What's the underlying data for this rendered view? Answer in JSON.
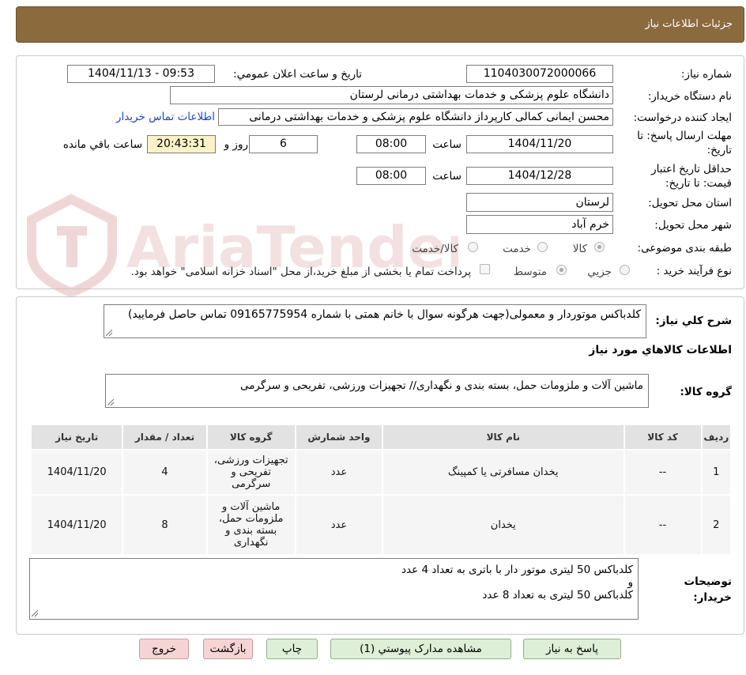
{
  "header": {
    "title": "جزئيات اطلاعات نياز"
  },
  "form": {
    "need_number_label": "شماره نياز:",
    "need_number": "1104030072000066",
    "announce_label": "تاريخ و ساعت اعلان عمومي:",
    "announce_value": "1404/11/13 - 09:53",
    "buyer_org_label": "نام دستگاه خريدار:",
    "buyer_org": "دانشگاه علوم پزشکی و خدمات بهداشتی درمانی لرستان",
    "requester_label": "ايجاد کننده درخواست:",
    "requester": "محسن ایمانی کمالی کارپرداز دانشگاه علوم پزشکی و خدمات بهداشتی درمانی",
    "contact_link": "اطلاعات تماس خريدار",
    "deadline_label_1": "مهلت ارسال پاسخ: تا",
    "deadline_label_2": "تاريخ:",
    "deadline_date": "1404/11/20",
    "time_word": "ساعت",
    "deadline_time": "08:00",
    "days": "6",
    "days_and": "روز و",
    "remaining": "20:43:31",
    "remaining_label": "ساعت باقي مانده",
    "validity_label_1": "حداقل تاريخ اعتبار",
    "validity_label_2": "قيمت: تا تاريخ:",
    "validity_date": "1404/12/28",
    "validity_time": "08:00",
    "province_label": "استان محل تحويل:",
    "province": "لرستان",
    "city_label": "شهر محل تحويل:",
    "city": "خرم آباد",
    "category_label": "طبقه بندی موضوعی:",
    "category_options": [
      "کالا",
      "خدمت",
      "کالا/خدمت"
    ],
    "process_label": "نوع فرآيند خريد :",
    "process_options": [
      "جزيي",
      "متوسط"
    ],
    "payment_note": "پرداخت تمام یا بخشی از مبلغ خرید،از محل \"اسناد خزانه اسلامی\" خواهد بود."
  },
  "summary": {
    "label": "شرح کلي نياز:",
    "text": "کلدباکس موتوردار و معمولی(جهت هرگونه سوال با خانم همتی با شماره 09165775954 تماس حاصل فرمایید)"
  },
  "goods_section": {
    "title": "اطلاعات کالاهاي مورد نياز",
    "group_label": "گروه کالا:",
    "group_text": "ماشین آلات و ملزومات حمل، بسته بندی و نگهداری// تجهیزات ورزشی، تفریحی و سرگرمی"
  },
  "table": {
    "headers": [
      "رديف",
      "کد کالا",
      "نام کالا",
      "واحد شمارش",
      "گروه کالا",
      "تعداد / مقدار",
      "تاريخ نياز"
    ],
    "rows": [
      [
        "1",
        "--",
        "یخدان مسافرتی یا کمپینگ",
        "عدد",
        "تجهیزات ورزشی، تفریحی و سرگرمی",
        "4",
        "1404/11/20"
      ],
      [
        "2",
        "--",
        "یخدان",
        "عدد",
        "ماشین آلات و ملزومات حمل، بسته بندی و نگهداری",
        "8",
        "1404/11/20"
      ]
    ]
  },
  "buyer_notes": {
    "label_1": "توضيحات",
    "label_2": "خريدار:",
    "line1": "کلدباکس 50 لیتری موتور دار با باتری به تعداد 4 عدد",
    "line2": "و",
    "line3": "کلدباکس 50 لیتری به تعداد 8 عدد"
  },
  "buttons": {
    "respond": "پاسخ به نياز",
    "attachments": "مشاهده مدارک پيوستي (1)",
    "print": "چاپ",
    "back": "بازگشت",
    "exit": "خروج"
  },
  "watermark_text": "AriaTender.neT",
  "colors": {
    "header": "#8b6a3e",
    "link": "#1a47c4",
    "remaining_bg": "#fbf3c8",
    "green_btn": "#ddf0d7",
    "pink_btn": "#f7d4d4"
  }
}
